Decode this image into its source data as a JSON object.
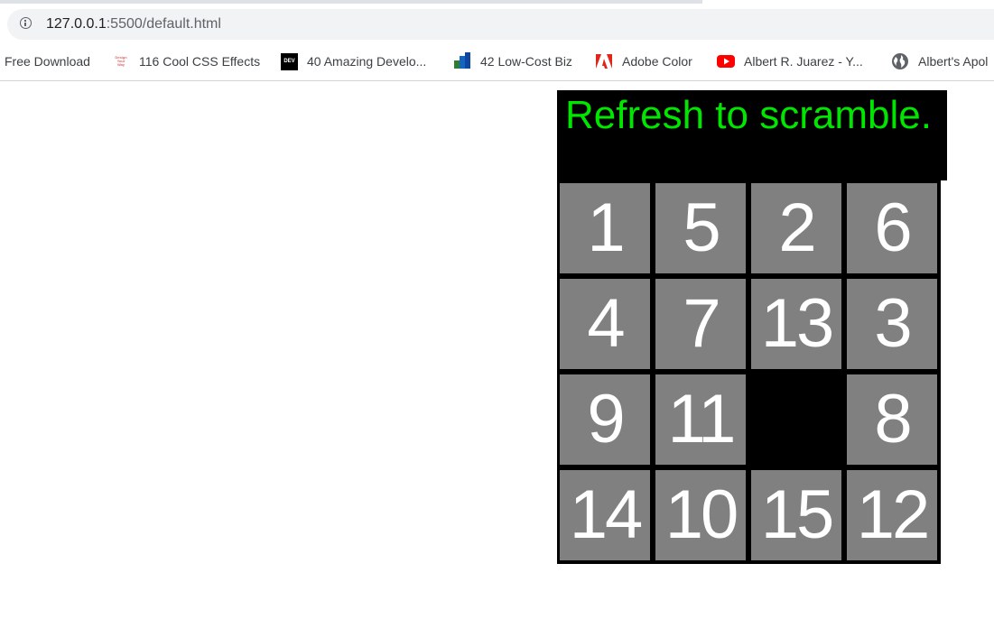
{
  "browser": {
    "url_host": "127.0.0.1",
    "url_rest": ":5500/default.html",
    "bookmarks": [
      {
        "label": "Free Download",
        "icon": "none"
      },
      {
        "label": "116 Cool CSS Effects",
        "icon": "design-your-way-icon",
        "icon_text": [
          "Design",
          "Your",
          "Way"
        ]
      },
      {
        "label": "40 Amazing Develo...",
        "icon": "dev-icon",
        "icon_text": "DEV"
      },
      {
        "label": "42 Low-Cost Biz",
        "icon": "bar-chart-icon"
      },
      {
        "label": "Adobe Color",
        "icon": "adobe-icon"
      },
      {
        "label": "Albert R. Juarez - Y...",
        "icon": "youtube-icon"
      },
      {
        "label": "Albert's Apol",
        "icon": "globe-icon"
      }
    ]
  },
  "page": {
    "title": "Refresh to scramble.",
    "title_color": "#00e600",
    "tile_color": "#808080",
    "tiles": [
      "1",
      "5",
      "2",
      "6",
      "4",
      "7",
      "13",
      "3",
      "9",
      "11",
      "",
      "8",
      "14",
      "10",
      "15",
      "12"
    ]
  }
}
